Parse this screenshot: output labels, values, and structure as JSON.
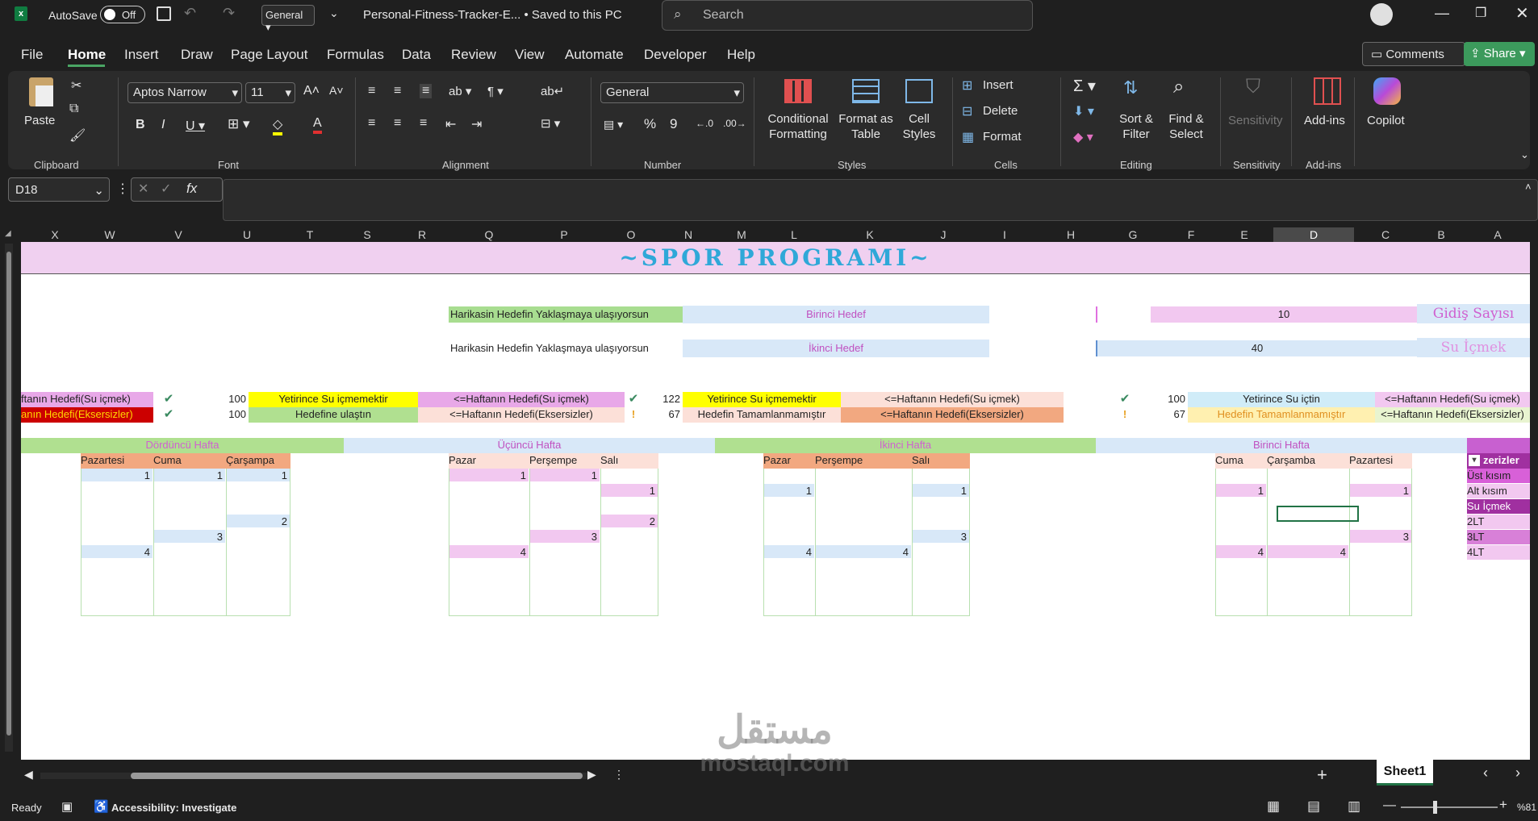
{
  "titlebar": {
    "autosave_label": "AutoSave",
    "autosave_state": "Off",
    "style_select": "General",
    "file_title": "Personal-Fitness-Tracker-E... • Saved to this PC",
    "search_placeholder": "Search"
  },
  "menu": {
    "items": [
      "File",
      "Home",
      "Insert",
      "Draw",
      "Page Layout",
      "Formulas",
      "Data",
      "Review",
      "View",
      "Automate",
      "Developer",
      "Help"
    ],
    "active": "Home",
    "comments_label": "Comments",
    "share_label": "Share"
  },
  "ribbon": {
    "clipboard": {
      "paste": "Paste",
      "group": "Clipboard"
    },
    "font": {
      "name": "Aptos Narrow",
      "size": "11",
      "group": "Font"
    },
    "alignment": {
      "group": "Alignment"
    },
    "number": {
      "format": "General",
      "group": "Number"
    },
    "styles": {
      "conditional": "Conditional\nFormatting",
      "format_table": "Format as\nTable",
      "cell_styles": "Cell\nStyles",
      "group": "Styles"
    },
    "cells": {
      "insert": "Insert",
      "delete": "Delete",
      "format": "Format",
      "group": "Cells"
    },
    "editing": {
      "sort": "Sort &\nFilter",
      "find": "Find &\nSelect",
      "group": "Editing"
    },
    "sensitivity": {
      "label": "Sensitivity",
      "group": "Sensitivity"
    },
    "addins": {
      "label": "Add-ins",
      "group": "Add-ins"
    },
    "copilot": {
      "label": "Copilot"
    }
  },
  "formula_bar": {
    "name_box": "D18",
    "fx": "fx",
    "content": ""
  },
  "columns": [
    "X",
    "W",
    "V",
    "U",
    "T",
    "S",
    "R",
    "Q",
    "P",
    "O",
    "N",
    "M",
    "L",
    "K",
    "J",
    "I",
    "H",
    "G",
    "F",
    "E",
    "D",
    "C",
    "B",
    "A"
  ],
  "sheet": {
    "title": "~SPOR PROGRAMI~",
    "goal1_msg": "Harikasin Hedefin Yaklaşmaya ulaşıyorsun",
    "goal1_label": "Birinci Hedef",
    "goal1_value": "10",
    "goal1_name": "Gidiş Sayısı",
    "goal2_msg": "Harikasin Hedefin Yaklaşmaya ulaşıyorsun",
    "goal2_label": "İkinci  Hedef",
    "goal2_value": "40",
    "goal2_name": "Su İçmek",
    "status_rows": [
      [
        "ftanın Hedefi(Su içmek)",
        "100",
        "Yetirince Su içmemektir",
        "<=Haftanın Hedefi(Su içmek)",
        "122",
        "Yetirince Su içmemektir",
        "<=Haftanın Hedefi(Su içmek)",
        "100",
        "Yetirince Su içtin",
        "<=Haftanın Hedefi(Su içmek)"
      ],
      [
        "anın Hedefi(Eksersizler)",
        "100",
        "Hedefine ulaştın",
        "<=Haftanın Hedefi(Eksersizler)",
        "67",
        "Hedefin Tamamlanmamıştır",
        "<=Haftanın Hedefi(Eksersizler)",
        "67",
        "Hedefin Tamamlanmamıştır",
        "<=Haftanın Hedefi(Eksersizler)"
      ]
    ],
    "weeks": [
      "Dördüncü Hafta",
      "Üçüncü Hafta",
      "İkinci Hafta",
      "Birinci Hafta"
    ],
    "week4_days": [
      "Pazartesi",
      "Cuma",
      "Çarşampa"
    ],
    "week3_days": [
      "Pazar",
      "Perşempe",
      "Salı"
    ],
    "week2_days": [
      "Pazar",
      "Perşempe",
      "Salı"
    ],
    "week1_days": [
      "Cuma",
      "Çarşamba",
      "Pazartesi"
    ],
    "exercise_header": "zerizler",
    "exercises": [
      "Üst kısım",
      "Alt kısım",
      "Su İçmek",
      "2LT",
      "3LT",
      "4LT"
    ],
    "values": {
      "w4": [
        [
          "1",
          "1",
          "1"
        ],
        [
          "",
          "",
          ""
        ],
        [
          "",
          "",
          ""
        ],
        [
          "",
          "",
          "2"
        ],
        [
          "",
          "3",
          ""
        ],
        [
          "4",
          "",
          ""
        ]
      ],
      "w3": [
        [
          "1",
          "1",
          ""
        ],
        [
          "",
          "",
          "1"
        ],
        [
          "",
          "",
          ""
        ],
        [
          "",
          "",
          "2"
        ],
        [
          "",
          "3",
          ""
        ],
        [
          "4",
          "",
          ""
        ]
      ],
      "w2": [
        [
          "",
          "",
          ""
        ],
        [
          "1",
          "",
          "1"
        ],
        [
          "",
          "",
          ""
        ],
        [
          "",
          "",
          ""
        ],
        [
          "",
          "",
          "3"
        ],
        [
          "4",
          "4",
          ""
        ]
      ],
      "w1": [
        [
          "",
          "",
          ""
        ],
        [
          "1",
          "",
          "1"
        ],
        [
          "",
          "",
          ""
        ],
        [
          "",
          "",
          ""
        ],
        [
          "",
          "",
          "3"
        ],
        [
          "4",
          "4",
          ""
        ]
      ]
    }
  },
  "tabs": {
    "sheet_name": "Sheet1"
  },
  "statusbar": {
    "ready": "Ready",
    "accessibility": "Accessibility: Investigate",
    "zoom": "%81"
  },
  "watermark": {
    "line1": "مستقل",
    "line2": "mostaql.com"
  }
}
